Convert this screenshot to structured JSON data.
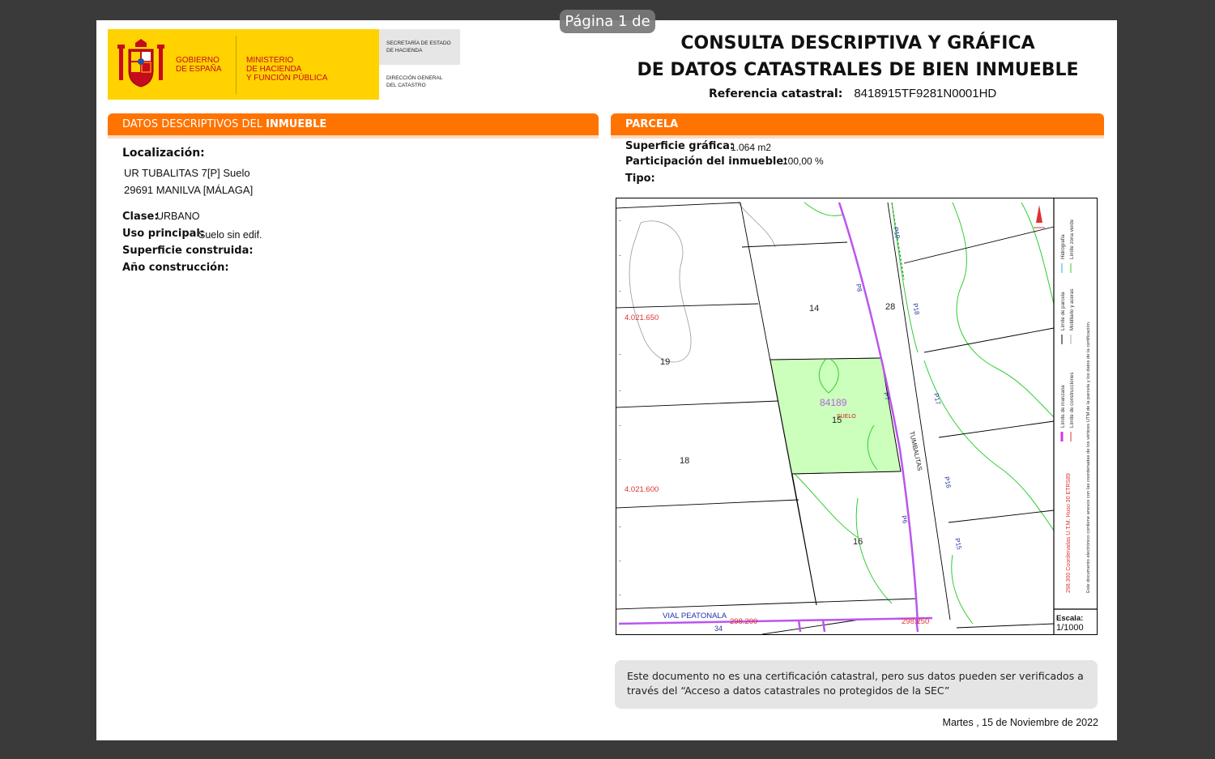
{
  "viewer": {
    "page_indicator": "Página 1 de 1"
  },
  "header": {
    "gov_line1": "GOBIERNO",
    "gov_line2": "DE ESPAÑA",
    "ministry_line1": "MINISTERIO",
    "ministry_line2": "DE HACIENDA",
    "ministry_line3": "Y FUNCIÓN PÚBLICA",
    "secretaria_line1": "SECRETARÍA DE ESTADO",
    "secretaria_line2": "DE HACIENDA",
    "direccion_line1": "DIRECCIÓN GENERAL",
    "direccion_line2": "DEL CATASTRO",
    "title_line1": "CONSULTA DESCRIPTIVA Y GRÁFICA",
    "title_line2": "DE DATOS CATASTRALES DE BIEN INMUEBLE",
    "ref_label": "Referencia catastral:",
    "ref_value": "8418915TF9281N0001HD"
  },
  "colors": {
    "accent": "#ff7300",
    "brand_yellow": "#ffd200",
    "brand_red": "#c60b1e",
    "parcel_fill": "#ccffbb"
  },
  "descriptivos": {
    "title_prefix": "DATOS DESCRIPTIVOS DEL ",
    "title_bold": "INMUEBLE",
    "localizacion_label": "Localización:",
    "address_line1": "UR TUBALITAS 7[P] Suelo",
    "address_line2": "29691 MANILVA [MÁLAGA]",
    "clase_label": "Clase:",
    "clase_value": "URBANO",
    "uso_label": "Uso principal:",
    "uso_value": "Suelo sin edif.",
    "superficie_label": "Superficie construida:",
    "anio_label": "Año construcción:"
  },
  "parcela": {
    "title": "PARCELA",
    "superficie_label": "Superficie gráfica:",
    "superficie_value": "1.064 m2",
    "participacion_label": "Participación del inmueble:",
    "participacion_value": "100,00 %",
    "tipo_label": "Tipo:"
  },
  "map": {
    "coord_y1": "4.021.650",
    "coord_y2": "4.021.600",
    "coord_x1": "298.200",
    "coord_x2": "298.250",
    "parcel_numbers": [
      "14",
      "28",
      "19",
      "15",
      "18",
      "16",
      "34"
    ],
    "parcel_ref": "84189",
    "suelo_label": "SUELO",
    "street_label": "TUMBALITAS",
    "vial_label": "VIAL PEATONALA",
    "vertex_labels": [
      "P19",
      "P8",
      "P18",
      "P7",
      "P17",
      "P16",
      "P6",
      "P15"
    ],
    "legend_title": "298.300 Coordenadas U.T.M. Huso 30 ETRS89",
    "legend_manzana": "Límite de manzana",
    "legend_parcela": "Límite de parcela",
    "legend_hidrografia": "Hidrografía",
    "legend_construcciones": "Límite de construcciones",
    "legend_mobiliario": "Mobiliario y aceras",
    "legend_zona_verde": "Límite zona verde",
    "legend_note": "Este documento electrónico contiene anexos con las coordenadas de los vértices UTM de la parcela y los datos de la certificación.",
    "scale_label": "Escala:",
    "scale_value": "1/1000"
  },
  "footer": {
    "note_line1": "Este documento no es una certificación catastral, pero sus datos pueden ser verificados a",
    "note_line2": "través del “Acceso a datos catastrales no protegidos de la SEC”",
    "date": "Martes , 15 de Noviembre de 2022"
  }
}
